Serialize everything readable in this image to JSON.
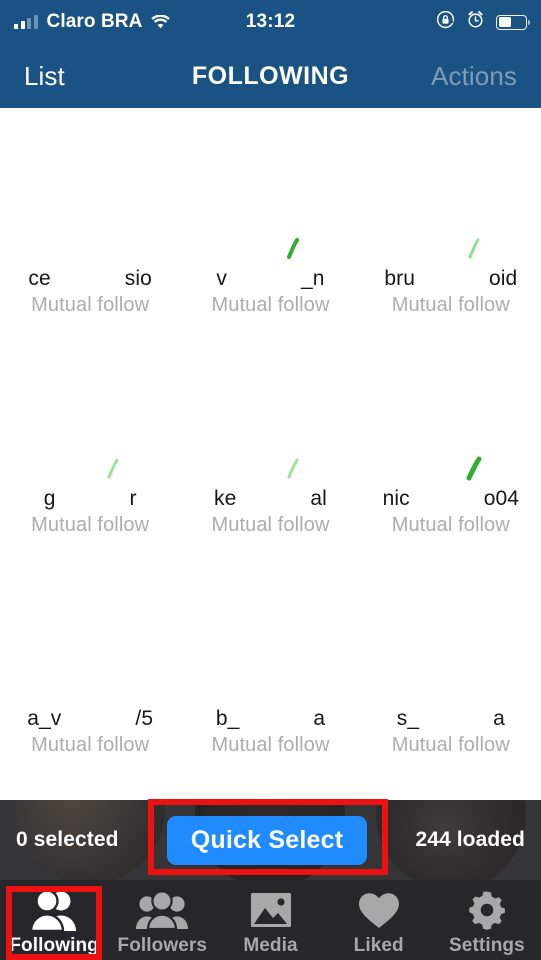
{
  "status_bar": {
    "carrier": "Claro BRA",
    "time": "13:12",
    "signal_icon": "cellular-signal-icon",
    "wifi_icon": "wifi-icon",
    "rotation_lock_icon": "rotation-lock-icon",
    "alarm_icon": "alarm-clock-icon",
    "battery_icon": "battery-icon",
    "battery_level_pct": 48
  },
  "nav_bar": {
    "left_label": "List",
    "title": "FOLLOWING",
    "right_label": "Actions",
    "background": "#1a5383",
    "active_color": "#ffffff",
    "inactive_color": "#7e9cb6"
  },
  "grid": {
    "status_text": "Mutual follow",
    "rows": [
      [
        {
          "name_start": "ce",
          "name_end": "sio",
          "status": "Mutual follow",
          "verified": true,
          "avatar_redacted": true
        },
        {
          "name_start": "v",
          "name_end": "_n",
          "status": "Mutual follow",
          "verified": true,
          "avatar_redacted": true
        },
        {
          "name_start": "bru",
          "name_end": "oid",
          "status": "Mutual follow",
          "verified": false,
          "avatar_redacted": true
        }
      ],
      [
        {
          "name_start": "g",
          "name_end": "r",
          "status": "Mutual follow",
          "verified": true,
          "avatar_redacted": true
        },
        {
          "name_start": "ke",
          "name_end": "al",
          "status": "Mutual follow",
          "verified": true,
          "avatar_redacted": true
        },
        {
          "name_start": "nic",
          "name_end": "o04",
          "status": "Mutual follow",
          "verified": true,
          "avatar_redacted": true
        }
      ],
      [
        {
          "name_start": "a_v",
          "name_end": "/5",
          "status": "Mutual follow",
          "verified": false,
          "avatar_redacted": true
        },
        {
          "name_start": "b_",
          "name_end": "a",
          "status": "Mutual follow",
          "verified": false,
          "avatar_redacted": true
        },
        {
          "name_start": "s_",
          "name_end": "a",
          "status": "Mutual follow",
          "verified": false,
          "avatar_redacted": true
        }
      ]
    ]
  },
  "action_bar": {
    "selected_label": "0 selected",
    "quick_select_label": "Quick Select",
    "loaded_label": "244 loaded",
    "button_color": "#1f8bff"
  },
  "tab_bar": {
    "background": "#26262b",
    "active_index": 0,
    "items": [
      {
        "label": "Following",
        "icon": "two-persons-filled-icon",
        "active": true
      },
      {
        "label": "Followers",
        "icon": "three-persons-icon",
        "active": false
      },
      {
        "label": "Media",
        "icon": "photo-icon",
        "active": false
      },
      {
        "label": "Liked",
        "icon": "heart-icon",
        "active": false
      },
      {
        "label": "Settings",
        "icon": "gear-icon",
        "active": false
      }
    ]
  },
  "annotations": {
    "highlight_color": "#ee1111",
    "boxes": [
      {
        "name": "quick-select-highlight",
        "target": "Quick Select"
      },
      {
        "name": "following-tab-highlight",
        "target": "Following"
      }
    ]
  }
}
